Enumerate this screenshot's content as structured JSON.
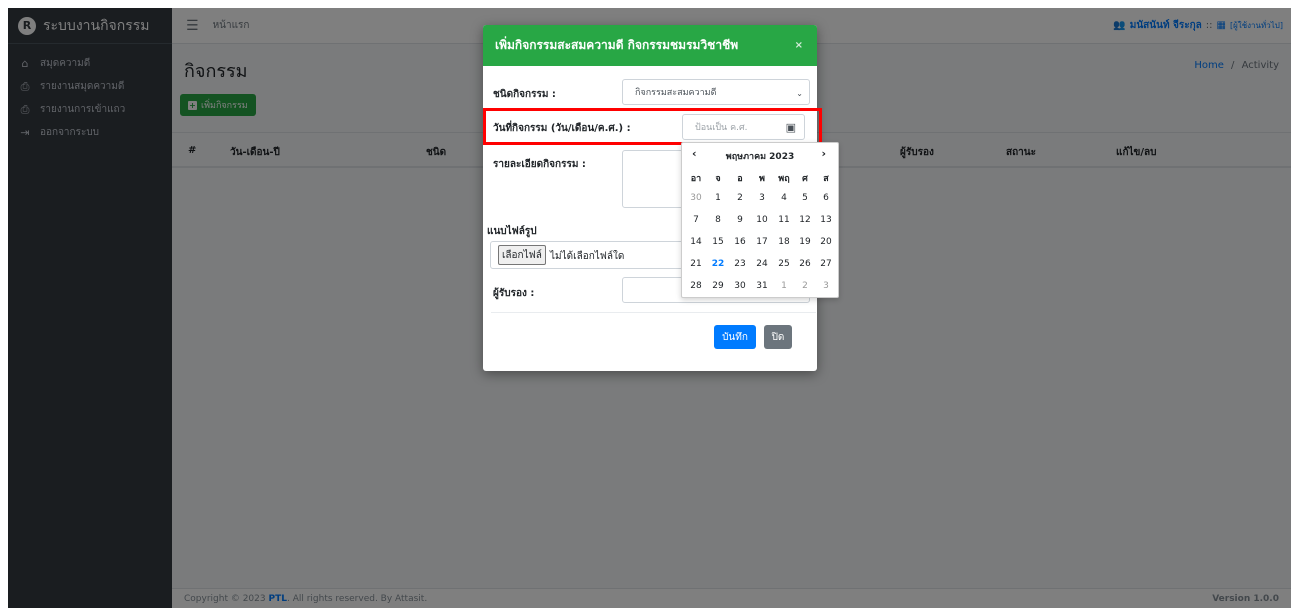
{
  "sidebar": {
    "brand_logo": "R",
    "brand": "ระบบงานกิจกรรม",
    "items": [
      {
        "label": "สมุดความดี",
        "icon": "home-icon"
      },
      {
        "label": "รายงานสมุดความดี",
        "icon": "print-icon"
      },
      {
        "label": "รายงานการเข้าแถว",
        "icon": "print-icon"
      },
      {
        "label": "ออกจากระบบ",
        "icon": "sign-out-icon"
      }
    ]
  },
  "topbar": {
    "home": "หน้าแรก",
    "user_name": "มนัสนันท์ จีระกุล",
    "separator": "::",
    "role": "[ผู้ใช้งานทั่วไป]"
  },
  "page": {
    "title": "กิจกรรม",
    "breadcrumb_home": "Home",
    "breadcrumb_sep": "/",
    "breadcrumb_current": "Activity",
    "add_button": "เพิ่มกิจกรรม",
    "columns": [
      "#",
      "วัน-เดือน-ปี",
      "ชนิด",
      "ผู้รับรอง",
      "สถานะ",
      "แก้ไข/ลบ"
    ]
  },
  "footer": {
    "copyright_pre": "Copyright © 2023",
    "brand": "PTL",
    "copyright_post": ". All rights reserved. By Attasit.",
    "version": "Version 1.0.0"
  },
  "modal": {
    "title": "เพิ่มกิจกรรมสะสมความดี กิจกรรมชมรมวิชาชีพ",
    "close": "×",
    "type_label": "ชนิดกิจกรรม :",
    "type_value": "กิจกรรมสะสมความดี",
    "date_label": "วันที่กิจกรรม (วัน/เดือน/ค.ศ.) :",
    "date_placeholder": "ป้อนเป็น ค.ศ.",
    "detail_label": "รายละเอียดกิจกรรม :",
    "file_label": "แนบไฟล์รูป",
    "file_button": "เลือกไฟล์",
    "file_status": "ไม่ได้เลือกไฟล์ใด",
    "approver_label": "ผู้รับรอง :",
    "save": "บันทึก",
    "close_button": "ปิด"
  },
  "calendar": {
    "prev": "‹",
    "next": "›",
    "title": "พฤษภาคม 2023",
    "weekdays": [
      "อา",
      "จ",
      "อ",
      "พ",
      "พฤ",
      "ศ",
      "ส"
    ],
    "weeks": [
      [
        "30",
        "1",
        "2",
        "3",
        "4",
        "5",
        "6"
      ],
      [
        "7",
        "8",
        "9",
        "10",
        "11",
        "12",
        "13"
      ],
      [
        "14",
        "15",
        "16",
        "17",
        "18",
        "19",
        "20"
      ],
      [
        "21",
        "22",
        "23",
        "24",
        "25",
        "26",
        "27"
      ],
      [
        "28",
        "29",
        "30",
        "31",
        "1",
        "2",
        "3"
      ]
    ],
    "today": "22"
  },
  "colors": {
    "primary": "#007bff",
    "success": "#28a745",
    "sidebar": "#343a40",
    "highlight": "#ff0000"
  }
}
